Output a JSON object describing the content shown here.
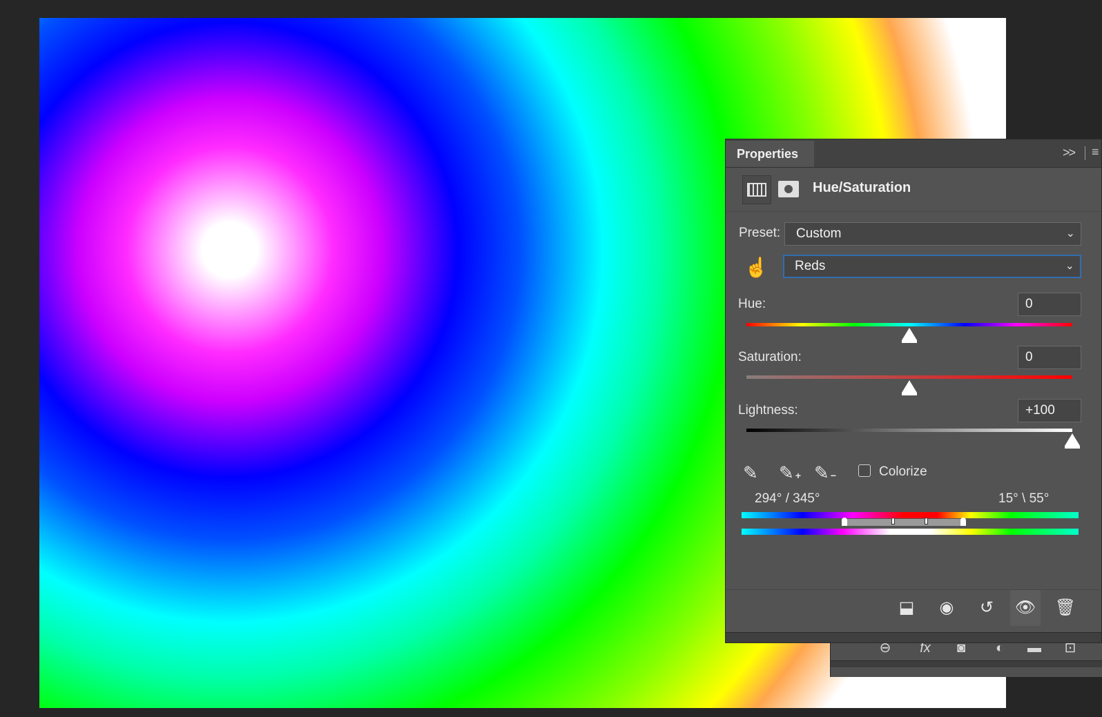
{
  "panel": {
    "tab_label": "Properties",
    "collapse_glyph": ">>",
    "menu_glyph": "≡",
    "adjustment_title": "Hue/Saturation"
  },
  "preset": {
    "label": "Preset:",
    "value": "Custom"
  },
  "channel": {
    "value": "Reds"
  },
  "sliders": {
    "hue": {
      "label": "Hue:",
      "value": "0",
      "level": 0.5
    },
    "saturation": {
      "label": "Saturation:",
      "value": "0",
      "level": 0.5
    },
    "lightness": {
      "label": "Lightness:",
      "value": "+100",
      "level": 1.0
    }
  },
  "colorize": {
    "label": "Colorize",
    "checked": false
  },
  "range": {
    "left": "294° /  345°",
    "right": "15° \\  55°"
  },
  "icons": {
    "adjustment": "hue-saturation-layer-icon",
    "mask": "layer-mask-icon",
    "targeted_adjustment": "hand-scrubby-icon",
    "eyedropper": "eyedropper-icon",
    "eyedropper_add": "eyedropper-plus-icon",
    "eyedropper_subtract": "eyedropper-minus-icon",
    "clip": "clip-to-layer-icon",
    "view_previous": "view-previous-state-icon",
    "reset": "reset-icon",
    "visibility": "eye-icon",
    "delete": "trash-icon"
  },
  "colors": {
    "panel_bg": "#535353",
    "focus_border": "#2f6fb0"
  }
}
